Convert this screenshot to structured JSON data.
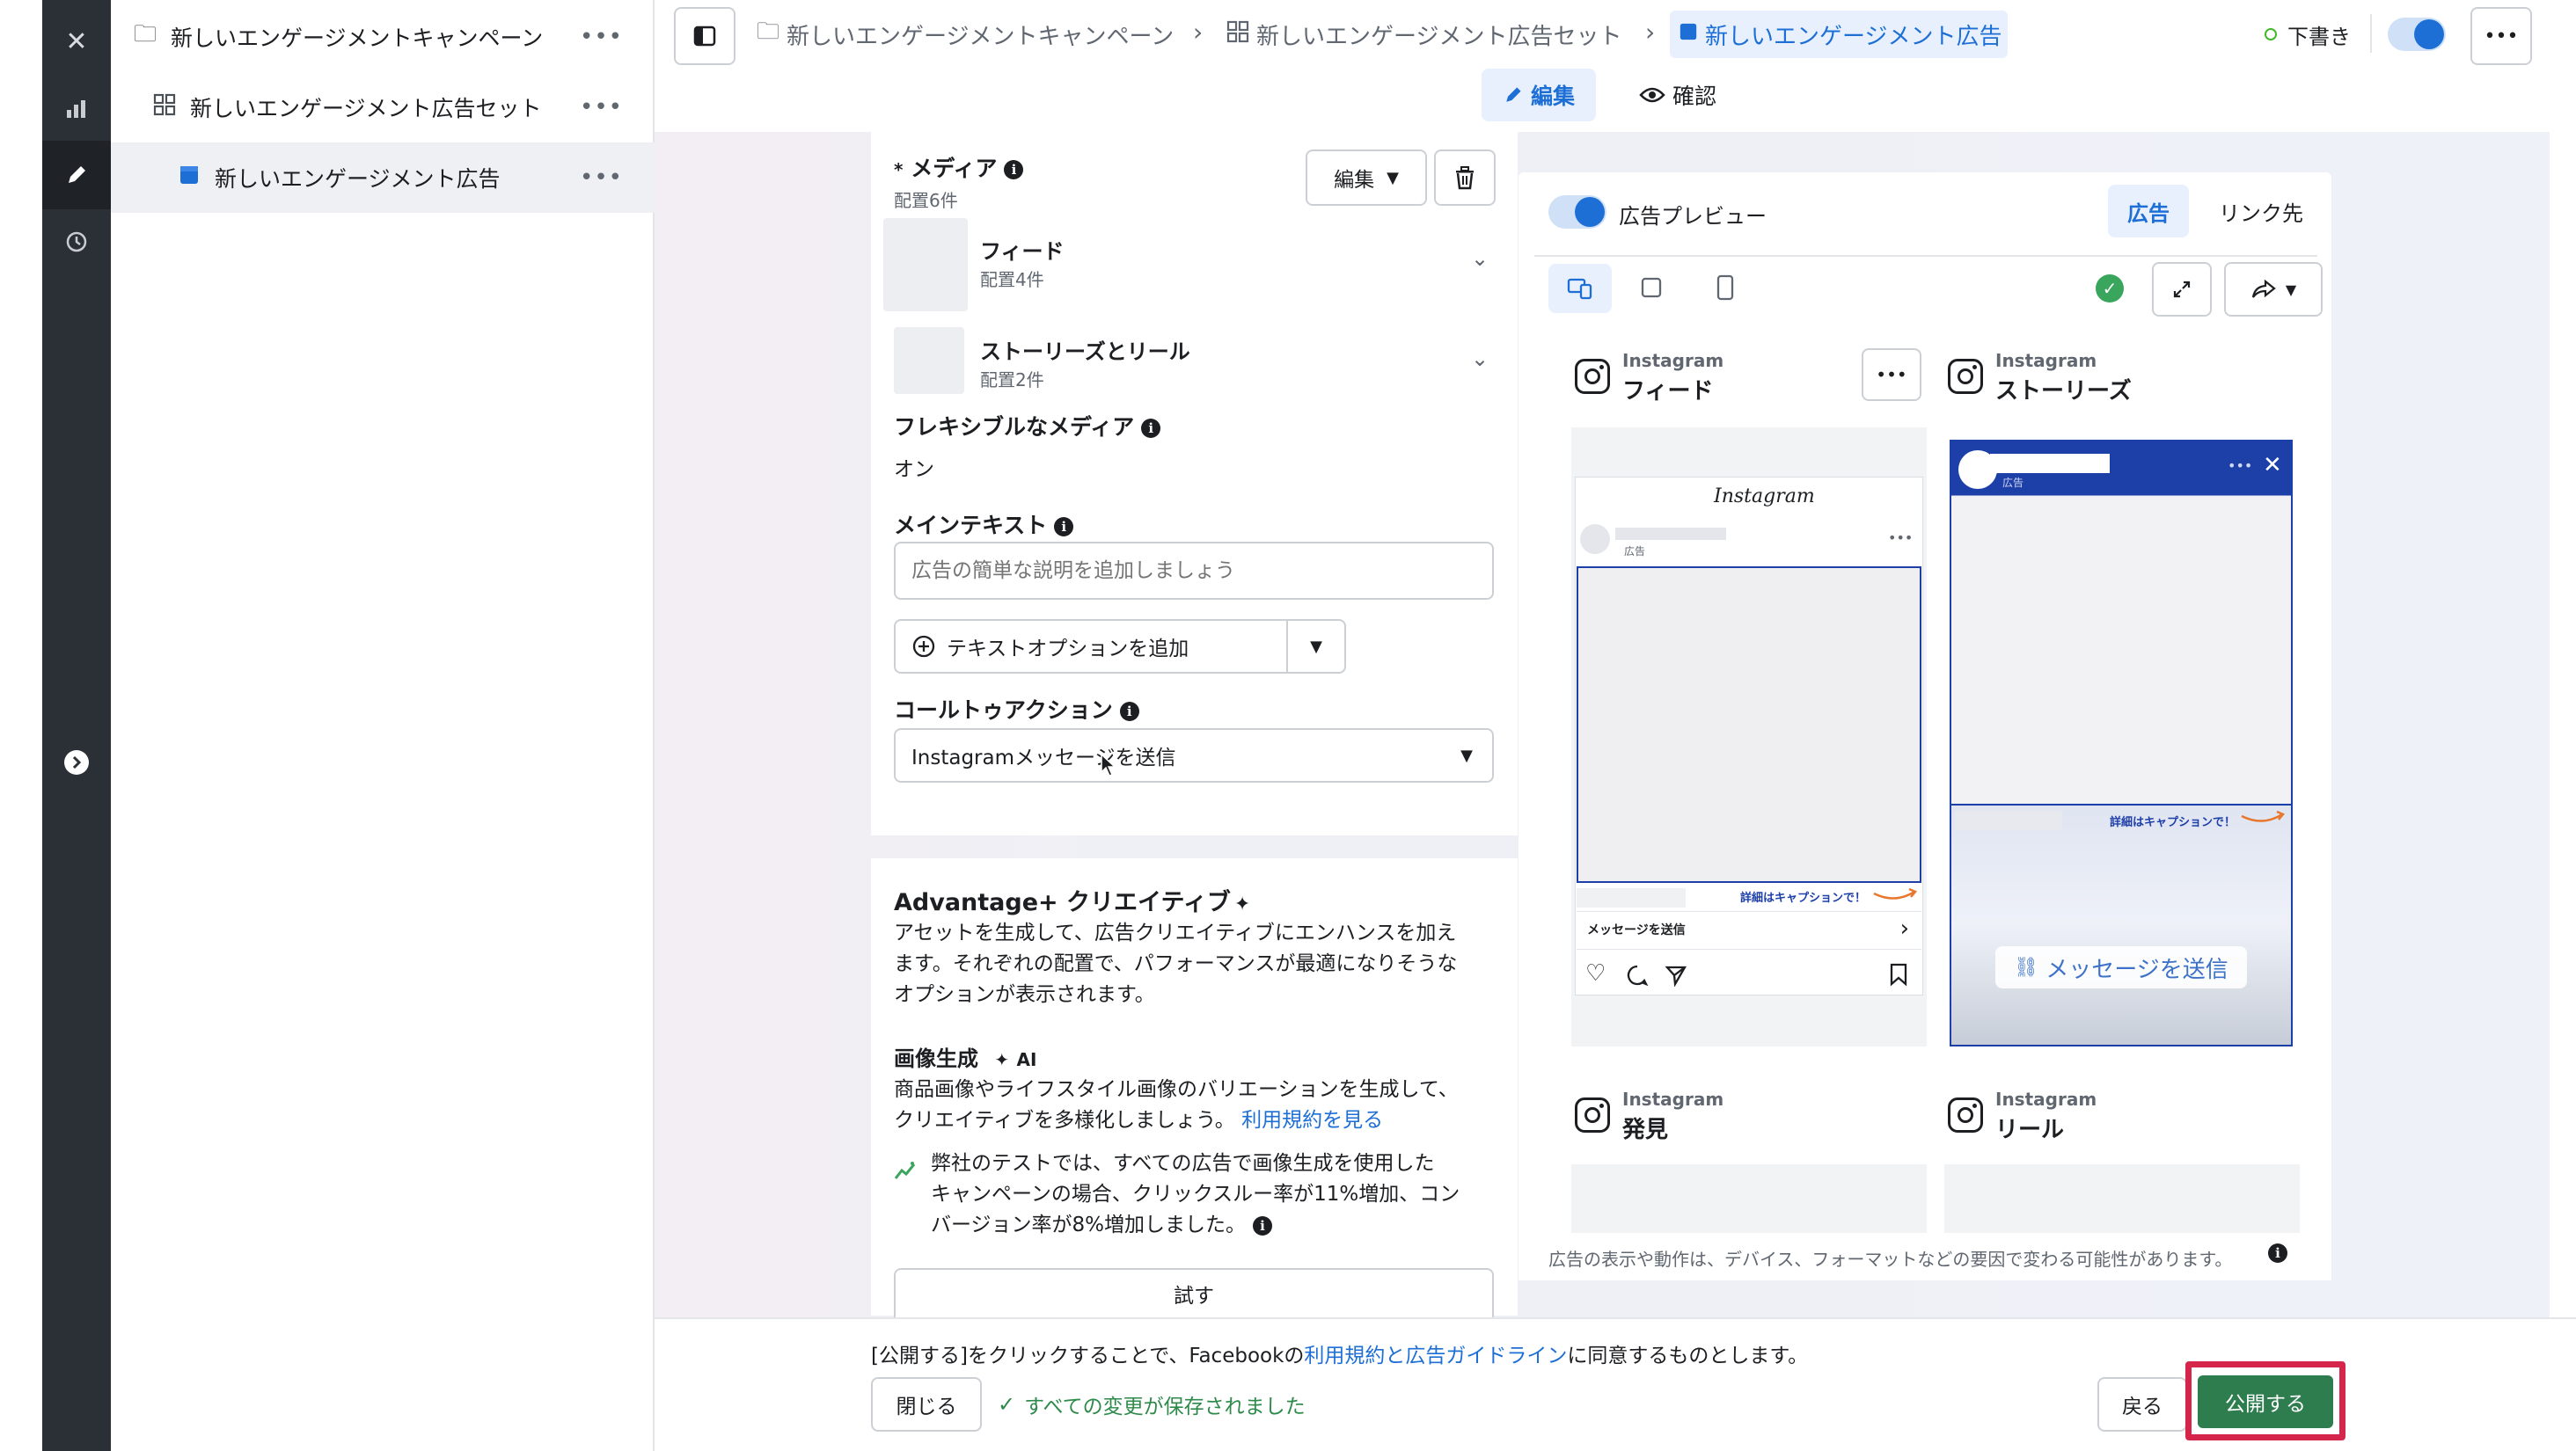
{
  "sidebar": {
    "campaign": "新しいエンゲージメントキャンペーン",
    "adset": "新しいエンゲージメント広告セット",
    "ad": "新しいエンゲージメント広告",
    "more": "•••"
  },
  "topbar": {
    "breadcrumb_campaign": "新しいエンゲージメントキャンペーン",
    "breadcrumb_adset": "新しいエンゲージメント広告セット",
    "breadcrumb_ad": "新しいエンゲージメント広告",
    "status": "下書き",
    "tab_edit": "編集",
    "tab_review": "確認"
  },
  "media": {
    "title": "メディア",
    "count": "配置6件",
    "edit_label": "編集",
    "feed_label": "フィード",
    "feed_count": "配置4件",
    "stories_label": "ストーリーズとリール",
    "stories_count": "配置2件"
  },
  "flexible_media": {
    "label": "フレキシブルなメディア",
    "value": "オン"
  },
  "main_text": {
    "label": "メインテキスト",
    "placeholder": "広告の簡単な説明を追加しましょう",
    "add_option": "テキストオプションを追加"
  },
  "cta": {
    "label": "コールトゥアクション",
    "value": "Instagramメッセージを送信"
  },
  "advantage": {
    "title": "Advantage+ クリエイティブ",
    "desc": [
      "アセットを生成して、広告クリエイティブにエンハンスを加え",
      "ます。それぞれの配置で、パフォーマンスが最適になりそうな",
      "オプションが表示されます。"
    ],
    "image_gen_title": "画像生成",
    "ai_badge": "AI",
    "image_gen_desc_1": "商品画像やライフスタイル画像のバリエーションを生成して、",
    "image_gen_desc_2": "クリエイティブを多様化しましょう。",
    "terms_link": "利用規約を見る",
    "test_note": [
      "弊社のテストでは、すべての広告で画像生成を使用した",
      "キャンペーンの場合、クリックスルー率が11%増加、コン",
      "バージョン率が8%増加しました。"
    ],
    "try_button": "試す"
  },
  "preview": {
    "toggle_label": "広告プレビュー",
    "tab_ad": "広告",
    "tab_link": "リンク先",
    "platform": "Instagram",
    "feed": "フィード",
    "stories": "ストーリーズ",
    "explore": "発見",
    "reels": "リール",
    "feed_app_name": "Instagram",
    "feed_sponsored": "広告",
    "feed_caption_hint": "詳細はキャプションで！",
    "feed_cta": "メッセージを送信",
    "stories_caption_hint": "詳細はキャプションで！",
    "stories_sponsored": "広告",
    "stories_cta": "メッセージを送信",
    "disclaimer": "広告の表示や動作は、デバイス、フォーマットなどの要因で変わる可能性があります。"
  },
  "footer": {
    "agree_prefix": "[公開する]をクリックすることで、Facebookの",
    "agree_link": "利用規約と広告ガイドライン",
    "agree_suffix": "に同意するものとします。",
    "close_button": "閉じる",
    "saved_status": "すべての変更が保存されました",
    "back_button": "戻る",
    "publish_button": "公開する"
  },
  "colors": {
    "accent": "#1d6fd6",
    "publish": "#2e7d4f",
    "highlight": "#d6254a",
    "rail": "#2b2f36"
  }
}
